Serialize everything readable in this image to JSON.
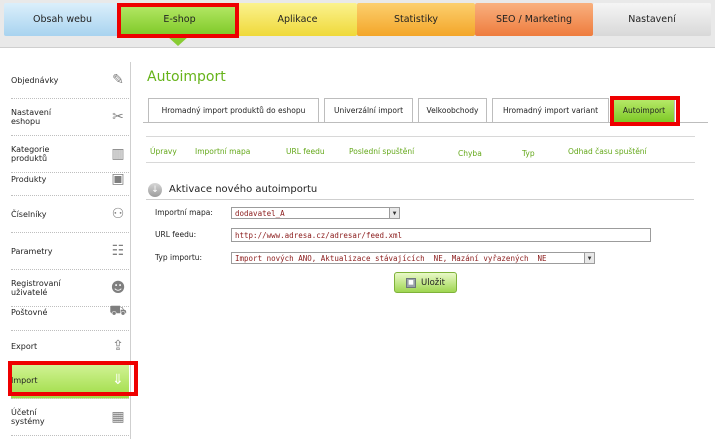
{
  "top_nav": {
    "tabs": [
      {
        "label": "Obsah webu",
        "color": "#a8d3ef"
      },
      {
        "label": "E-shop",
        "color": "#7ec927",
        "active": true
      },
      {
        "label": "Aplikace",
        "color": "#efd93a"
      },
      {
        "label": "Statistiky",
        "color": "#f3a629"
      },
      {
        "label": "SEO / Marketing",
        "color": "#ee7c3e"
      },
      {
        "label": "Nastavení",
        "color": "#d8d8d8"
      }
    ]
  },
  "sidebar": {
    "items": [
      {
        "label": "Objednávky",
        "icon": "edit-icon"
      },
      {
        "label": "Nastavení\neshopu",
        "icon": "tools-icon"
      },
      {
        "label": "Kategorie\nproduktů",
        "icon": "book-icon"
      },
      {
        "label": "Produkty",
        "icon": "box-icon"
      },
      {
        "label": "Číselníky",
        "icon": "binoculars-icon"
      },
      {
        "label": "Parametry",
        "icon": "sliders-icon"
      },
      {
        "label": "Registrovaní\nuživatelé",
        "icon": "users-icon"
      },
      {
        "label": "Poštovné",
        "icon": "truck-icon"
      },
      {
        "label": "Export",
        "icon": "upload-icon"
      },
      {
        "label": "Import",
        "icon": "download-icon",
        "active": true
      },
      {
        "label": "Účetní\nsystémy",
        "icon": "calculator-icon"
      }
    ]
  },
  "main": {
    "title": "Autoimport",
    "subtabs": [
      {
        "label": "Hromadný import produktů do eshopu"
      },
      {
        "label": "Univerzální import"
      },
      {
        "label": "Velkoobchody"
      },
      {
        "label": "Hromadný import variant"
      },
      {
        "label": "Autoimport",
        "active": true
      }
    ],
    "table_headers": [
      "Úpravy",
      "Importní mapa",
      "URL feedu",
      "Poslední spuštění",
      "Chyba",
      "Typ",
      "Odhad času spuštění"
    ],
    "section_title": "Aktivace nového autoimportu",
    "form": {
      "map_label": "Importní mapa:",
      "map_value": "dodavatel_A",
      "url_label": "URL feedu:",
      "url_value": "http://www.adresa.cz/adresar/feed.xml",
      "type_label": "Typ importu:",
      "type_value": "Import nových ANO, Aktualizace stávajících  NE, Mazání vyřazených  NE"
    },
    "save_label": "Uložit"
  },
  "highlight_color": "#ee0000"
}
